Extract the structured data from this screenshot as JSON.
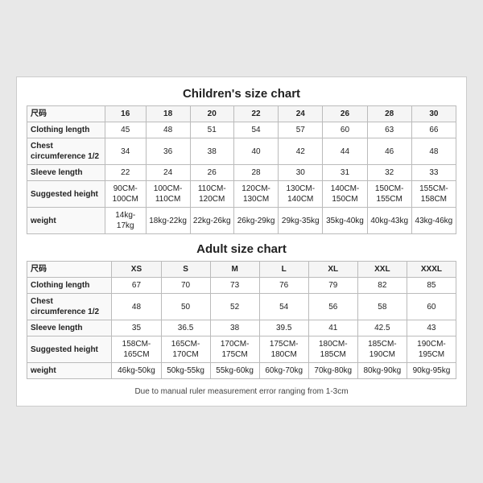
{
  "children_chart": {
    "title": "Children's size chart",
    "headers": [
      "尺码",
      "16",
      "18",
      "20",
      "22",
      "24",
      "26",
      "28",
      "30"
    ],
    "rows": [
      {
        "label": "Clothing length",
        "values": [
          "45",
          "48",
          "51",
          "54",
          "57",
          "60",
          "63",
          "66"
        ]
      },
      {
        "label": "Chest circumference 1/2",
        "values": [
          "34",
          "36",
          "38",
          "40",
          "42",
          "44",
          "46",
          "48"
        ]
      },
      {
        "label": "Sleeve length",
        "values": [
          "22",
          "24",
          "26",
          "28",
          "30",
          "31",
          "32",
          "33"
        ]
      },
      {
        "label": "Suggested height",
        "values": [
          "90CM-100CM",
          "100CM-110CM",
          "110CM-120CM",
          "120CM-130CM",
          "130CM-140CM",
          "140CM-150CM",
          "150CM-155CM",
          "155CM-158CM"
        ]
      },
      {
        "label": "weight",
        "values": [
          "14kg-17kg",
          "18kg-22kg",
          "22kg-26kg",
          "26kg-29kg",
          "29kg-35kg",
          "35kg-40kg",
          "40kg-43kg",
          "43kg-46kg"
        ]
      }
    ]
  },
  "adult_chart": {
    "title": "Adult size chart",
    "headers": [
      "尺码",
      "XS",
      "S",
      "M",
      "L",
      "XL",
      "XXL",
      "XXXL"
    ],
    "rows": [
      {
        "label": "Clothing length",
        "values": [
          "67",
          "70",
          "73",
          "76",
          "79",
          "82",
          "85"
        ]
      },
      {
        "label": "Chest circumference 1/2",
        "values": [
          "48",
          "50",
          "52",
          "54",
          "56",
          "58",
          "60"
        ]
      },
      {
        "label": "Sleeve length",
        "values": [
          "35",
          "36.5",
          "38",
          "39.5",
          "41",
          "42.5",
          "43"
        ]
      },
      {
        "label": "Suggested height",
        "values": [
          "158CM-165CM",
          "165CM-170CM",
          "170CM-175CM",
          "175CM-180CM",
          "180CM-185CM",
          "185CM-190CM",
          "190CM-195CM"
        ]
      },
      {
        "label": "weight",
        "values": [
          "46kg-50kg",
          "50kg-55kg",
          "55kg-60kg",
          "60kg-70kg",
          "70kg-80kg",
          "80kg-90kg",
          "90kg-95kg"
        ]
      }
    ]
  },
  "note": "Due to manual ruler measurement error ranging from 1-3cm"
}
